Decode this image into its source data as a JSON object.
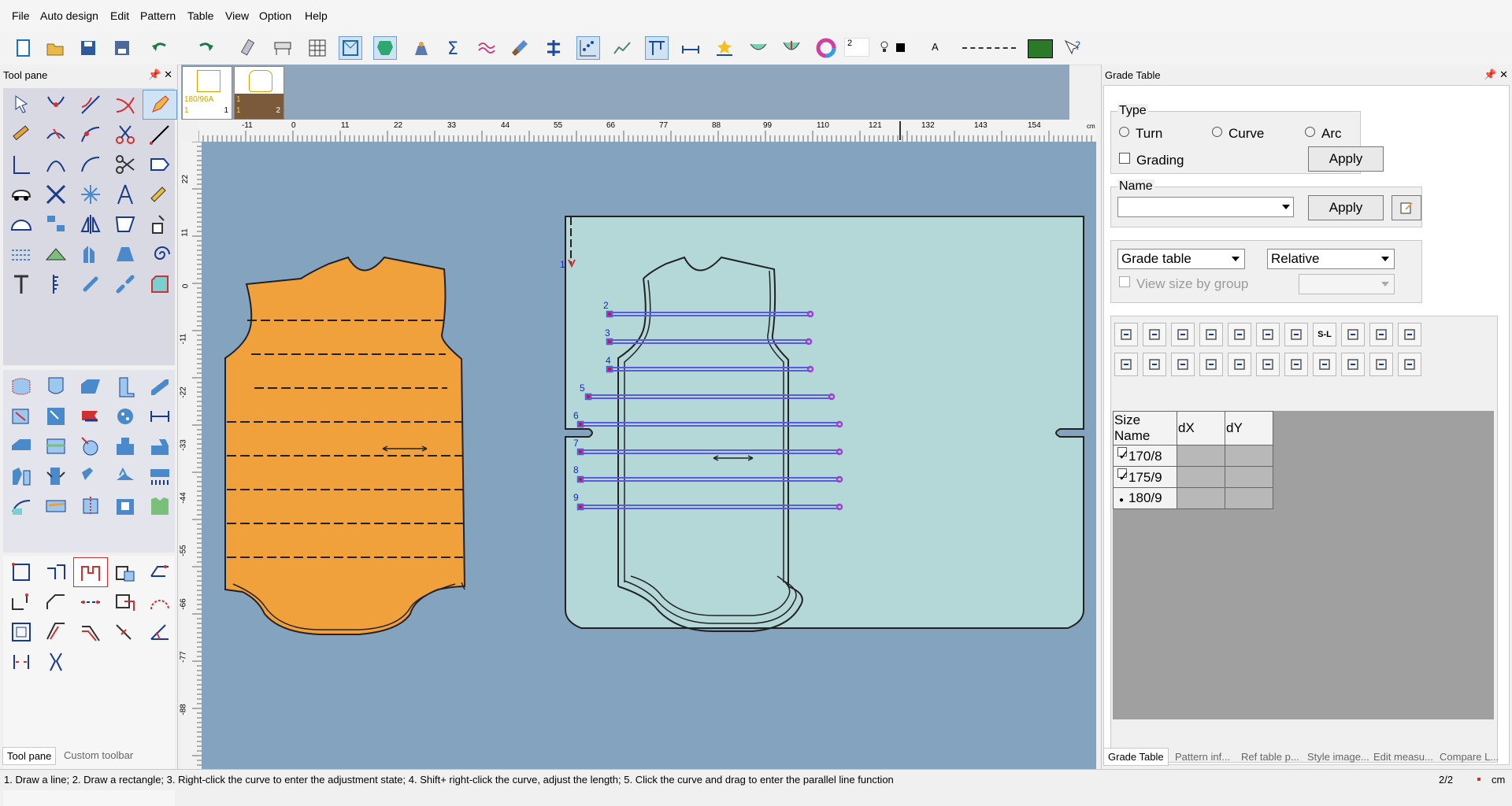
{
  "menu": [
    "File",
    "Auto design",
    "Edit",
    "Pattern",
    "Table",
    "View",
    "Option",
    "Help"
  ],
  "toolbar": {
    "icons": [
      "new-icon",
      "open-icon",
      "save-icon",
      "save-as-icon",
      "undo-icon",
      "redo-icon",
      "eraser-icon",
      "plotter-icon",
      "grid-icon",
      "display-piece-icon",
      "fill-piece-icon",
      "weight-icon",
      "sum-icon",
      "compare-lines-icon",
      "brush-icon",
      "align-icon",
      "grade-points-icon",
      "line-chart-icon",
      "grade-tool-icon",
      "measure-icon",
      "star-measure-icon",
      "seam-icon",
      "curve-seam-icon",
      "color-wheel-icon"
    ],
    "line_width": "2",
    "font_label": "A"
  },
  "tool_pane": {
    "title": "Tool pane",
    "pin": "📌",
    "close": "✕",
    "tabs": [
      "Tool pane",
      "Custom toolbar"
    ]
  },
  "thumbnails": [
    {
      "size": "180/96A",
      "left": "1",
      "right": "1"
    },
    {
      "size": "1",
      "left": "1",
      "right": "2"
    }
  ],
  "ruler": {
    "h_ticks": [
      "-11",
      "0",
      "11",
      "22",
      "33",
      "44",
      "55",
      "66",
      "77",
      "88",
      "99",
      "110",
      "121",
      "132",
      "143",
      "154"
    ],
    "h_unit": "cm",
    "v_ticks": [
      "22",
      "11",
      "0",
      "-11",
      "-22",
      "-33",
      "-44",
      "-55",
      "-66",
      "-77",
      "-88"
    ]
  },
  "canvas": {
    "line_numbers": [
      "1",
      "2",
      "3",
      "4",
      "5",
      "6",
      "7",
      "8",
      "9"
    ],
    "colors": {
      "background": "#84a3bf",
      "piece_fill": "#f0a13c",
      "board_fill": "#b4d8d8",
      "line_blue": "#5a5ae0",
      "mark_red": "#ff0000"
    }
  },
  "grade_panel": {
    "title": "Grade Table",
    "pin": "📌",
    "close": "✕",
    "type": {
      "legend": "Type",
      "options": [
        "Turn",
        "Curve",
        "Arc"
      ],
      "grading_label": "Grading",
      "apply": "Apply"
    },
    "name": {
      "legend": "Name",
      "value": "",
      "apply": "Apply"
    },
    "grade_select": "Grade table",
    "mode_select": "Relative",
    "view_by_group": "View size by group",
    "row1_buttons": [
      "copy-icon",
      "paste-icon",
      "paste-x-icon",
      "paste-y-icon",
      "mirror-x-icon",
      "mirror-y-icon",
      "flip-icon",
      "s-l-icon",
      "table-icon",
      "list-icon",
      "down-arrow-icon"
    ],
    "row2_buttons": [
      "prev-icon",
      "next-icon",
      "align-vertical-icon",
      "align-horizontal-icon",
      "distribute-icon",
      "bars-icon",
      "lines-icon",
      "step-icon",
      "format-icon",
      "stack-icon",
      "grade-toggle-icon"
    ],
    "s_l_label": "S-L",
    "table": {
      "headers": [
        "Size Name",
        "dX",
        "dY"
      ],
      "rows": [
        {
          "name": "170/8",
          "checked": true,
          "dx": "",
          "dy": ""
        },
        {
          "name": "175/9",
          "checked": true,
          "dx": "",
          "dy": ""
        },
        {
          "name": "180/9",
          "checked": false,
          "dx": "",
          "dy": ""
        }
      ]
    },
    "tabs": [
      "Grade Table",
      "Pattern inf...",
      "Ref table p...",
      "Style image...",
      "Edit measu...",
      "Compare L..."
    ]
  },
  "status": {
    "hint": "1. Draw a line; 2. Draw a rectangle; 3. Right-click the curve to enter the adjustment state; 4. Shift+ right-click the curve, adjust the length; 5. Click the curve and drag to enter the parallel line function",
    "page": "2/2",
    "unit": "cm"
  }
}
